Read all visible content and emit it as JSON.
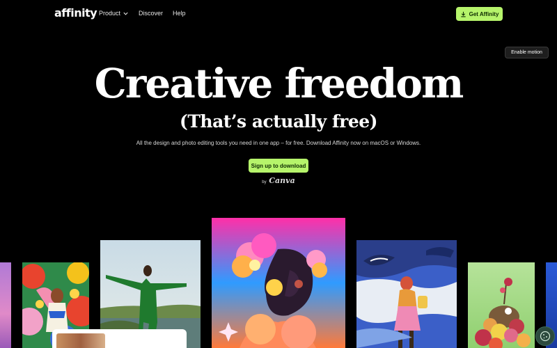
{
  "nav": {
    "logo": "affinity",
    "links": [
      "Product",
      "Discover",
      "Help"
    ],
    "cta": "Get Affinity",
    "motion": "Enable motion"
  },
  "hero": {
    "title": "Creative freedom",
    "subtitle": "(That’s actually free)",
    "description": "All the design and photo editing tools you need in one app – for free. Download Affinity now on macOS or Windows.",
    "signup": "Sign up to download",
    "by": "by",
    "canva": "Canva"
  },
  "gallery": {
    "cards": [
      "purple-abstract",
      "floral-illustration",
      "green-suit-portrait",
      "flower-hair-portrait",
      "whale-illustration",
      "flower-sculpture",
      "blue-edge"
    ]
  },
  "colors": {
    "accent": "#b6f46b",
    "background": "#000000"
  }
}
